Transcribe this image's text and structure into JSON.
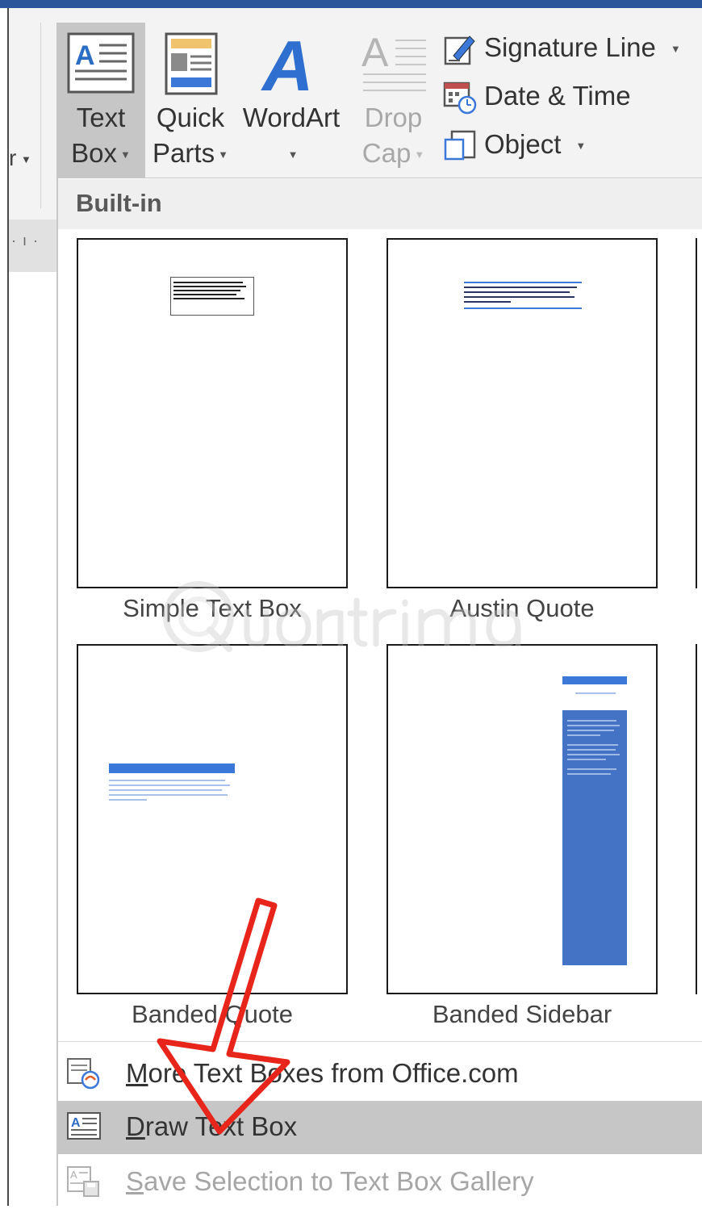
{
  "ribbon": {
    "text_box": {
      "line1": "Text",
      "line2": "Box"
    },
    "quick_parts": {
      "line1": "Quick",
      "line2": "Parts"
    },
    "wordart": {
      "line1": "WordArt"
    },
    "drop_cap": {
      "line1": "Drop",
      "line2": "Cap"
    },
    "signature_line": "Signature Line",
    "date_time": "Date & Time",
    "object": "Object"
  },
  "gallery": {
    "section_title": "Built-in",
    "items": [
      {
        "label": "Simple Text Box"
      },
      {
        "label": "Austin Quote"
      },
      {
        "label": "Banded Quote"
      },
      {
        "label": "Banded Sidebar"
      }
    ]
  },
  "menu": {
    "more": {
      "prefix": "",
      "mnemonic": "M",
      "rest": "ore Text Boxes from Office.com"
    },
    "draw": {
      "prefix": "",
      "mnemonic": "D",
      "rest": "raw Text Box"
    },
    "save": {
      "prefix": "",
      "mnemonic": "S",
      "rest": "ave Selection to Text Box Gallery"
    }
  },
  "colors": {
    "accent_blue": "#3c78d8",
    "ribbon_bg": "#f3f3f3",
    "selected_bg": "#c6c6c6",
    "annotation_red": "#e8251a"
  },
  "icons": {
    "text_box": "text-box-icon",
    "quick_parts": "quick-parts-icon",
    "wordart": "wordart-icon",
    "drop_cap": "drop-cap-icon",
    "signature_line": "signature-line-icon",
    "date_time": "date-time-icon",
    "object": "object-icon"
  }
}
